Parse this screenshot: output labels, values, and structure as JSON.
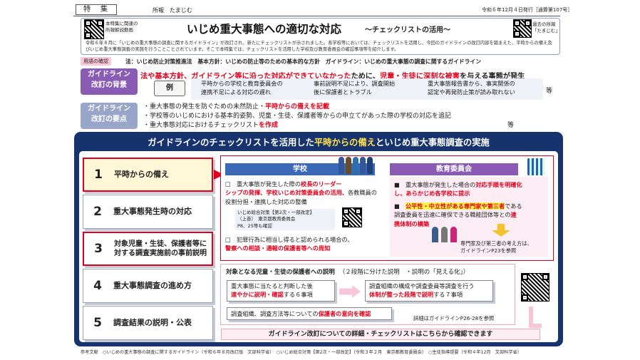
{
  "header": {
    "badge": "特　集",
    "dept": "所報　たまじむ",
    "issue": "令和６年12月４日発行［通算第107号］",
    "qr_left_caption": "本特集に関連の\n所報解説動画",
    "qr_right_caption": "過去の所報\n「たまじむ」"
  },
  "title": {
    "main": "いじめ重大事態への適切な対応",
    "sub": "～チェックリストの活用～",
    "intro": "令和６年８月に「いじめの重大事態の調査に関するガイドライン」が改訂され、新たにチェックリストが示されました。各学校等においては、チェックリストを活用し、今回のガイドラインの改訂内容を踏まえた、平時からの備え及びいじめ重大事態調査の実施を行うことことされています。そこで本特集では、チェックリストを活用した学校及び教育委員会の確認事項等を紹介します。"
  },
  "terms": {
    "label": "用語の確認",
    "text": "法：いじめ防止対策推進法　基本方針：いじめの防止等のための基本的な方針　ガイドライン：いじめの重大事態の調査に関するガイドライン"
  },
  "background": {
    "label": "ガイドライン\n改訂の背景",
    "headline_a": "法や基本方針、ガイドライン等に沿った対応ができていなかった",
    "headline_b": "ために、",
    "headline_c": "児童・生徒に深刻な被害",
    "headline_d": "を与える事態が発生",
    "example_tag": "例",
    "ex1": "平時からの学校と教育委員会の\n連携不足による対応の遅れ",
    "ex2": "事前説明不足により、調査開始\n後に保護者とトラブル",
    "ex3": "重大事態報告書から、事実関係の\n認定や再発防止策が読み取れない",
    "etc": "等"
  },
  "points": {
    "label": "ガイドライン\n改訂の要点",
    "p1a": "・重大事態の発生を防ぐための未然防止・",
    "p1b": "平時からの備えを記載",
    "p2": "・学校等のいじめにおける基本的姿勢、児童・生徒、保護者等からの申立てがあった際の学校の対応を追記",
    "p3a": "・重大事態対応におけるチェックリスト",
    "p3b": "を作成",
    "etc": "等"
  },
  "panel": {
    "title_a": "ガイドラインのチェックリストを活用した",
    "title_b": "平時からの備え",
    "title_c": "といじめ重大事態調査の実施"
  },
  "steps": [
    {
      "n": "1",
      "t": "平時からの備え"
    },
    {
      "n": "2",
      "t": "重大事態発生時の対応"
    },
    {
      "n": "3",
      "t": "対象児童・生徒、保護者等に\n対する調査実施前の事前説明"
    },
    {
      "n": "4",
      "t": "重大事態調査の進め方"
    },
    {
      "n": "5",
      "t": "調査結果の説明・公表"
    }
  ],
  "school": {
    "head": "学校",
    "i1a": "重大事態が発生した際の",
    "i1b": "校長のリーダー\nシップの発揮、学校いじめ対策委員会の活用、",
    "i1c": "各教職員の役割分担・連携した対応の整備",
    "ref": "いじめ総合対策【第2次・一部改定】\n（上巻）　東京都教育委員会\nP8、25等も確認",
    "i2a": "犯罪行為に相当し得ると認められる場合の、",
    "i2b": "警察への相談・通報の保護者等への周知"
  },
  "board": {
    "head": "教育委員会",
    "i1a": "重大事態が発生した場合の",
    "i1b": "対応手順を明確化\nし、あらかじめ各学校に提示",
    "i2a": "公平性・中立性がある専門家や第三者",
    "i2b": "である\n調査委員を迅速に確保できる職能団体等との",
    "i2c": "連\n携体制の構築",
    "note": "専門家及び第三者の考え方は、\nガイドラインP23を参照"
  },
  "explain": {
    "title": "対象となる児童・生徒の保護者への説明",
    "title2": "（２段階に分けた説明　・説明の「見える化」）",
    "a1": "重大事態に当たると判断した後",
    "a2": "速やかに説明・確認",
    "a3": "する６事項",
    "b1": "調査組織の構成や調査委員等調査を行う",
    "b2": "体制が整った段階で説明",
    "b3": "する７事項",
    "c1": "調査組織、調査方法等についての",
    "c2": "保護者の意向を確認",
    "detail": "詳細はガイドラインP26-28を参照"
  },
  "bottom_banner": "ガイドライン改訂についての詳細・チェックリストはこちらから確認できます",
  "footer": "参考文献　○いじめの重大事態の調査に関するガイドライン（令和６年８月改訂版　文部科学省）　○いじめ総合対策【第2次・一部改定】（令和３年２月　東京都教育委員会）　○生徒指導提要（令和４年12月　文部科学省）",
  "colors": {
    "navy": "#17336e",
    "red": "#e0001b",
    "tag_purple": "#8a5bb5",
    "school_blue": "#3b69b8",
    "pink": "#f7d9ea",
    "yellow": "#fff34d"
  }
}
